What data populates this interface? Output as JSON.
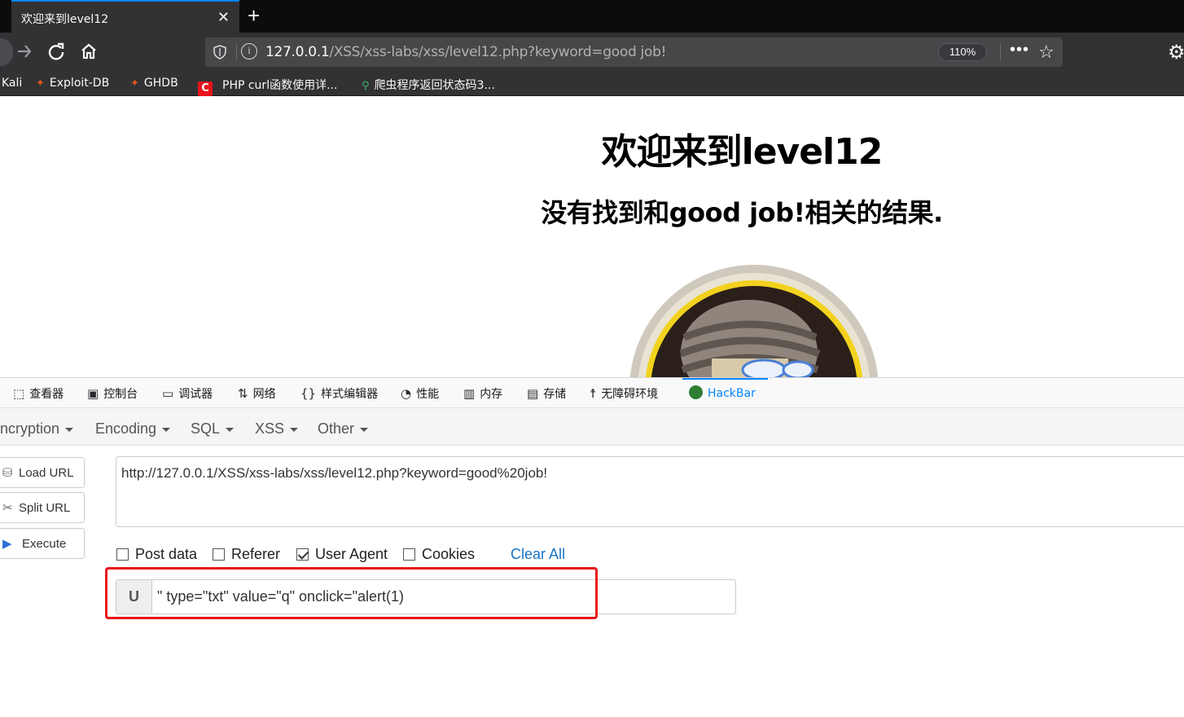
{
  "browser": {
    "tab_title": "欢迎来到level12",
    "url_prefix": "127.0.0.1",
    "url_rest": "/XSS/xss-labs/xss/level12.php?keyword=good job!",
    "zoom": "110%",
    "bookmarks": [
      {
        "label": "Kali",
        "icon": "kali-icon"
      },
      {
        "label": "Exploit-DB",
        "icon": "exploit-db-icon",
        "color": "#e0551e"
      },
      {
        "label": "GHDB",
        "icon": "ghdb-icon",
        "color": "#e0551e"
      },
      {
        "label": "PHP curl函数使用详...",
        "icon": "csdn-icon",
        "color": "#e8141b"
      },
      {
        "label": "爬虫程序返回状态码3...",
        "icon": "map-pin-icon",
        "color": "#3cb371"
      }
    ]
  },
  "page": {
    "title": "欢迎来到level12",
    "subtitle": "没有找到和good job!相关的结果."
  },
  "devtools": {
    "tabs": [
      {
        "label": "查看器",
        "icon": "inspector-icon"
      },
      {
        "label": "控制台",
        "icon": "console-icon"
      },
      {
        "label": "调试器",
        "icon": "debugger-icon"
      },
      {
        "label": "网络",
        "icon": "network-icon"
      },
      {
        "label": "样式编辑器",
        "icon": "style-editor-icon"
      },
      {
        "label": "性能",
        "icon": "performance-icon"
      },
      {
        "label": "内存",
        "icon": "memory-icon"
      },
      {
        "label": "存储",
        "icon": "storage-icon"
      },
      {
        "label": "无障碍环境",
        "icon": "accessibility-icon"
      },
      {
        "label": "HackBar",
        "icon": "hackbar-icon",
        "active": true
      }
    ]
  },
  "hackbar": {
    "menu": [
      "ncryption",
      "Encoding",
      "SQL",
      "XSS",
      "Other"
    ],
    "buttons": {
      "load": "Load URL",
      "split": "Split URL",
      "execute": "Execute"
    },
    "url": "http://127.0.0.1/XSS/xss-labs/xss/level12.php?keyword=good%20job!",
    "options": {
      "post_data": "Post data",
      "referer": "Referer",
      "user_agent": "User Agent",
      "cookies": "Cookies",
      "user_agent_checked": true,
      "post_data_checked": false,
      "referer_checked": false,
      "cookies_checked": false
    },
    "clear_all": "Clear All",
    "ua_addon": "U",
    "ua_value": "\" type=\"txt\" value=\"q\" onclick=\"alert(1)",
    "highlight_color": "#e8141b"
  }
}
